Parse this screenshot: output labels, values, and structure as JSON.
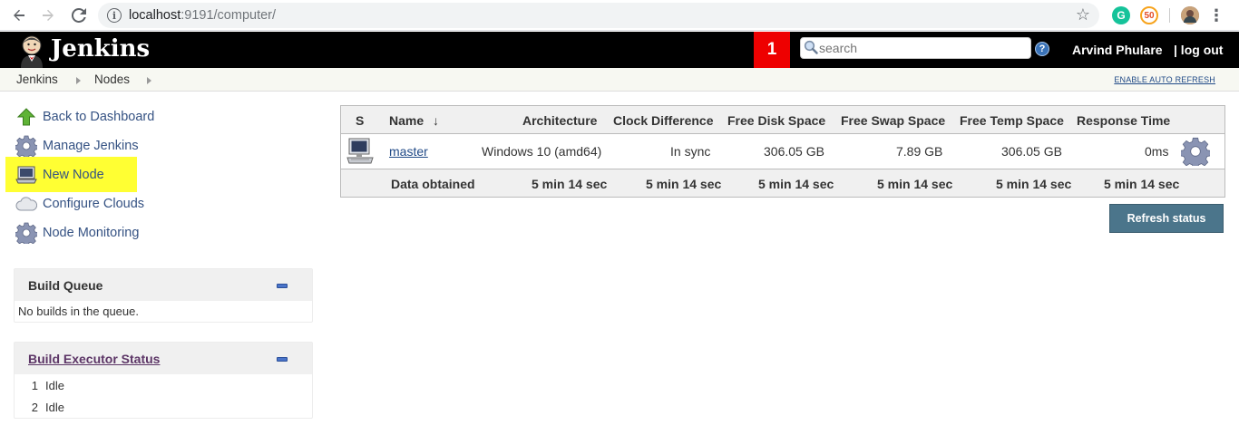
{
  "browser": {
    "url_host": "localhost",
    "url_rest": ":9191/computer/"
  },
  "header": {
    "logo_text": "Jenkins",
    "notification_count": "1",
    "search_placeholder": "search",
    "help_label": "?",
    "user_name": "Arvind Phulare",
    "logout_label": "| log out"
  },
  "breadcrumbs": {
    "items": [
      "Jenkins",
      "Nodes"
    ],
    "auto_refresh": "ENABLE AUTO REFRESH"
  },
  "sidebar": {
    "tasks": [
      {
        "label": "Back to Dashboard",
        "icon": "up-arrow-icon"
      },
      {
        "label": "Manage Jenkins",
        "icon": "gear-icon"
      },
      {
        "label": "New Node",
        "icon": "computer-icon"
      },
      {
        "label": "Configure Clouds",
        "icon": "cloud-icon"
      },
      {
        "label": "Node Monitoring",
        "icon": "gear-icon"
      }
    ],
    "highlighted_task": "New Node"
  },
  "build_queue": {
    "title": "Build Queue",
    "empty_text": "No builds in the queue."
  },
  "executor_status": {
    "title": "Build Executor Status",
    "executors": [
      {
        "num": "1",
        "status": "Idle"
      },
      {
        "num": "2",
        "status": "Idle"
      }
    ]
  },
  "nodes_table": {
    "headers": {
      "s": "S",
      "name": "Name",
      "sort_arrow": "↓",
      "architecture": "Architecture",
      "clock": "Clock Difference",
      "disk": "Free Disk Space",
      "swap": "Free Swap Space",
      "temp": "Free Temp Space",
      "response": "Response Time"
    },
    "row": {
      "name": "master",
      "architecture": "Windows 10 (amd64)",
      "clock": "In sync",
      "disk": "306.05 GB",
      "swap": "7.89 GB",
      "temp": "306.05 GB",
      "response": "0ms"
    },
    "footer": {
      "label": "Data obtained",
      "architecture": "5 min 14 sec",
      "clock": "5 min 14 sec",
      "disk": "5 min 14 sec",
      "swap": "5 min 14 sec",
      "temp": "5 min 14 sec",
      "response": "5 min 14 sec"
    }
  },
  "refresh_button": "Refresh status",
  "colors": {
    "header_bg": "#000000",
    "notification_bg": "#ee0000",
    "highlight": "#ffff33",
    "link": "#204a87",
    "refresh_button": "#4b758b"
  }
}
